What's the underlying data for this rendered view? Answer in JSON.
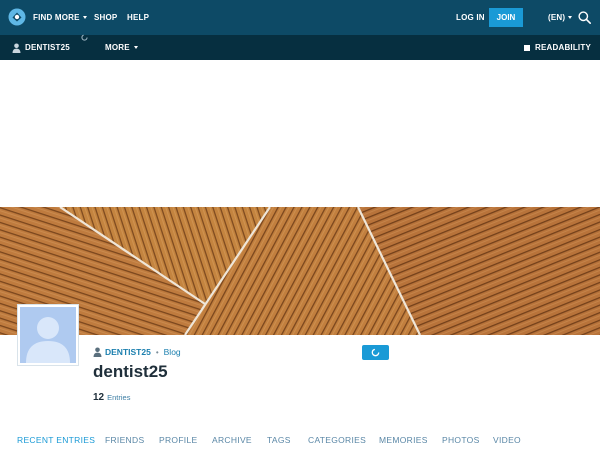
{
  "topbar": {
    "find_more": "FIND MORE",
    "shop": "SHOP",
    "help": "HELP",
    "login": "LOG IN",
    "join": "JOIN",
    "language": "(EN)"
  },
  "subbar": {
    "username": "DENTIST25",
    "more": "MORE",
    "readability": "READABILITY"
  },
  "profile": {
    "crumb_user": "DENTIST25",
    "crumb_separator": "•",
    "crumb_section": "Blog",
    "journal_title": "dentist25",
    "entries_count": "12",
    "entries_label": "Entries"
  },
  "tabs": [
    {
      "label": "RECENT ENTRIES",
      "active": true
    },
    {
      "label": "FRIENDS"
    },
    {
      "label": "PROFILE"
    },
    {
      "label": "ARCHIVE"
    },
    {
      "label": "TAGS"
    },
    {
      "label": "CATEGORIES"
    },
    {
      "label": "MEMORIES"
    },
    {
      "label": "PHOTOS"
    },
    {
      "label": "VIDEO"
    }
  ],
  "colors": {
    "topbar": "#0d4a66",
    "subbar": "#062f40",
    "accent": "#1a9ad6",
    "link": "#1b7fae",
    "banner_wood": "#b9743a"
  },
  "icons": [
    "logo-icon",
    "search-icon",
    "user-icon",
    "loading-spinner-icon",
    "readability-icon",
    "chevron-down-icon"
  ]
}
